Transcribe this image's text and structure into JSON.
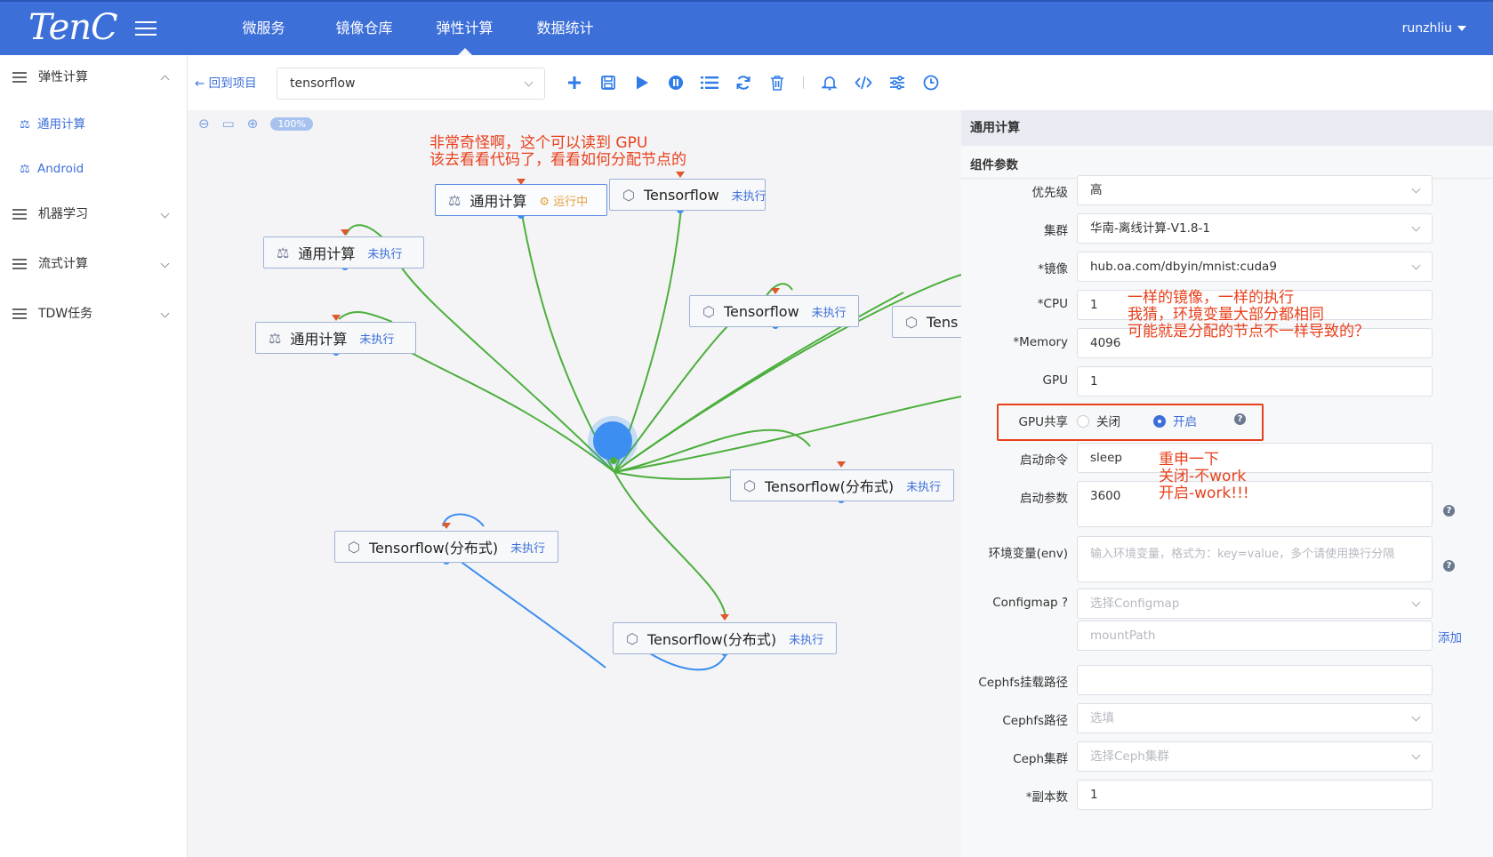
{
  "header": {
    "logo": "TenC",
    "nav": [
      {
        "label": "微服务",
        "active": false
      },
      {
        "label": "镜像仓库",
        "active": false
      },
      {
        "label": "弹性计算",
        "active": true
      },
      {
        "label": "数据统计",
        "active": false
      }
    ],
    "user": "runzhliu",
    "accent_color": "#3d6fd9"
  },
  "sidebar": {
    "groups": [
      {
        "label": "弹性计算",
        "expanded": true,
        "items": [
          {
            "label": "通用计算"
          },
          {
            "label": "Android"
          }
        ]
      },
      {
        "label": "机器学习",
        "expanded": false
      },
      {
        "label": "流式计算",
        "expanded": false
      },
      {
        "label": "TDW任务",
        "expanded": false
      }
    ]
  },
  "toolbar": {
    "back_label": "回到项目",
    "project_value": "tensorflow",
    "icons": [
      "add-icon",
      "save-icon",
      "play-icon",
      "pause-icon",
      "list-icon",
      "refresh-icon",
      "trash-icon",
      "bell-icon",
      "code-icon",
      "settings-icon",
      "clock-icon"
    ]
  },
  "canvas": {
    "zoom_label": "100%",
    "annotation": [
      "非常奇怪啊，这个可以读到 GPU",
      "该去看看代码了，看看如何分配节点的"
    ],
    "nodes": [
      {
        "id": "n1",
        "label": "通用计算",
        "status": "运行中",
        "running": true,
        "icon": "scale-icon"
      },
      {
        "id": "n2",
        "label": "Tensorflow",
        "status": "未执行",
        "icon": "hexagon-icon"
      },
      {
        "id": "n3",
        "label": "通用计算",
        "status": "未执行",
        "icon": "scale-icon"
      },
      {
        "id": "n4",
        "label": "通用计算",
        "status": "未执行",
        "icon": "scale-icon"
      },
      {
        "id": "n5",
        "label": "Tensorflow",
        "status": "未执行",
        "icon": "hexagon-icon"
      },
      {
        "id": "n6",
        "label": "Tens",
        "status": "",
        "icon": "hexagon-icon"
      },
      {
        "id": "n7",
        "label": "Tensorflow(分布式)",
        "status": "未执行",
        "icon": "hexagon-icon"
      },
      {
        "id": "n8",
        "label": "Tensorflow(分布式)",
        "status": "未执行",
        "icon": "hexagon-icon"
      },
      {
        "id": "n9",
        "label": "Tensorflow(分布式)",
        "status": "未执行",
        "icon": "hexagon-icon"
      }
    ],
    "edge_color": "#4caf3c",
    "hub_color": "#3d8ef0"
  },
  "panel": {
    "title": "通用计算",
    "section": "组件参数",
    "fields": {
      "priority": {
        "label": "优先级",
        "value": "高"
      },
      "cluster": {
        "label": "集群",
        "value": "华南-离线计算-V1.8-1"
      },
      "image": {
        "label": "*镜像",
        "value": "hub.oa.com/dbyin/mnist:cuda9"
      },
      "cpu": {
        "label": "*CPU",
        "value": "1"
      },
      "memory": {
        "label": "*Memory",
        "value": "4096"
      },
      "gpu": {
        "label": "GPU",
        "value": "1"
      },
      "gpu_share": {
        "label": "GPU共享",
        "off": "关闭",
        "on": "开启",
        "selected": "开启"
      },
      "command": {
        "label": "启动命令",
        "value": "sleep"
      },
      "args": {
        "label": "启动参数",
        "value": "3600"
      },
      "env": {
        "label": "环境变量(env)",
        "placeholder": "输入环境变量，格式为：key=value，多个请使用换行分隔"
      },
      "configmap": {
        "label": "Configmap ?",
        "placeholder": "选择Configmap"
      },
      "mountpath": {
        "placeholder": "mountPath"
      },
      "add_label": "添加",
      "cephfs_mount": {
        "label": "Cephfs挂载路径",
        "value": ""
      },
      "cephfs_path": {
        "label": "Cephfs路径",
        "placeholder": "选填"
      },
      "ceph_cluster": {
        "label": "Ceph集群",
        "placeholder": "选择Ceph集群"
      },
      "replicas": {
        "label": "*副本数",
        "value": "1"
      }
    },
    "annotation_image": [
      "一样的镜像，一样的执行",
      "我猜，环境变量大部分都相同",
      "可能就是分配的节点不一样导致的？"
    ],
    "annotation_gpu": [
      "重申一下",
      "关闭-不work",
      "开启-work!!!"
    ],
    "highlight_color": "#e8401c"
  }
}
